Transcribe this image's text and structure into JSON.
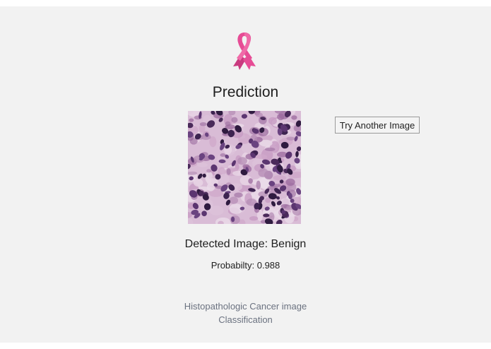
{
  "heading": "Prediction",
  "icons": {
    "logo": "pink-ribbon-icon"
  },
  "colors": {
    "ribbon": "#e64c95",
    "background": "#f2f2f2",
    "footer_text": "#6b7280"
  },
  "actions": {
    "try_another_label": "Try Another Image"
  },
  "result": {
    "detected": "Detected Image: Benign",
    "probability": "Probabilty: 0.988"
  },
  "footer": {
    "line1": "Histopathologic Cancer image",
    "line2": "Classification"
  }
}
